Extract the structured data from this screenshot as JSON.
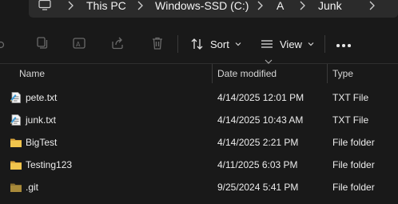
{
  "address_bar": {
    "crumbs": [
      "This PC",
      "Windows-SSD (C:)",
      "A",
      "Junk"
    ]
  },
  "command_bar": {
    "sort_label": "Sort",
    "view_label": "View",
    "icons": [
      "copy-icon",
      "paste-icon",
      "rename-icon",
      "share-icon",
      "delete-icon",
      "sort-icon",
      "view-icon",
      "more-icon"
    ]
  },
  "columns": {
    "name": "Name",
    "date": "Date modified",
    "type": "Type"
  },
  "files": [
    {
      "name": "pete.txt",
      "date": "4/14/2025 12:01 PM",
      "type": "TXT File",
      "icon": "text-file-icon"
    },
    {
      "name": "junk.txt",
      "date": "4/14/2025 10:43 AM",
      "type": "TXT File",
      "icon": "text-file-icon"
    },
    {
      "name": "BigTest",
      "date": "4/14/2025 2:21 PM",
      "type": "File folder",
      "icon": "folder-icon"
    },
    {
      "name": "Testing123",
      "date": "4/11/2025 6:03 PM",
      "type": "File folder",
      "icon": "folder-icon"
    },
    {
      "name": ".git",
      "date": "9/25/2024 5:41 PM",
      "type": "File folder",
      "icon": "hidden-folder-icon"
    }
  ],
  "colors": {
    "background": "#191919",
    "folder": "#f1c54d",
    "hidden_folder": "#a88a3a",
    "text": "#ececec"
  }
}
